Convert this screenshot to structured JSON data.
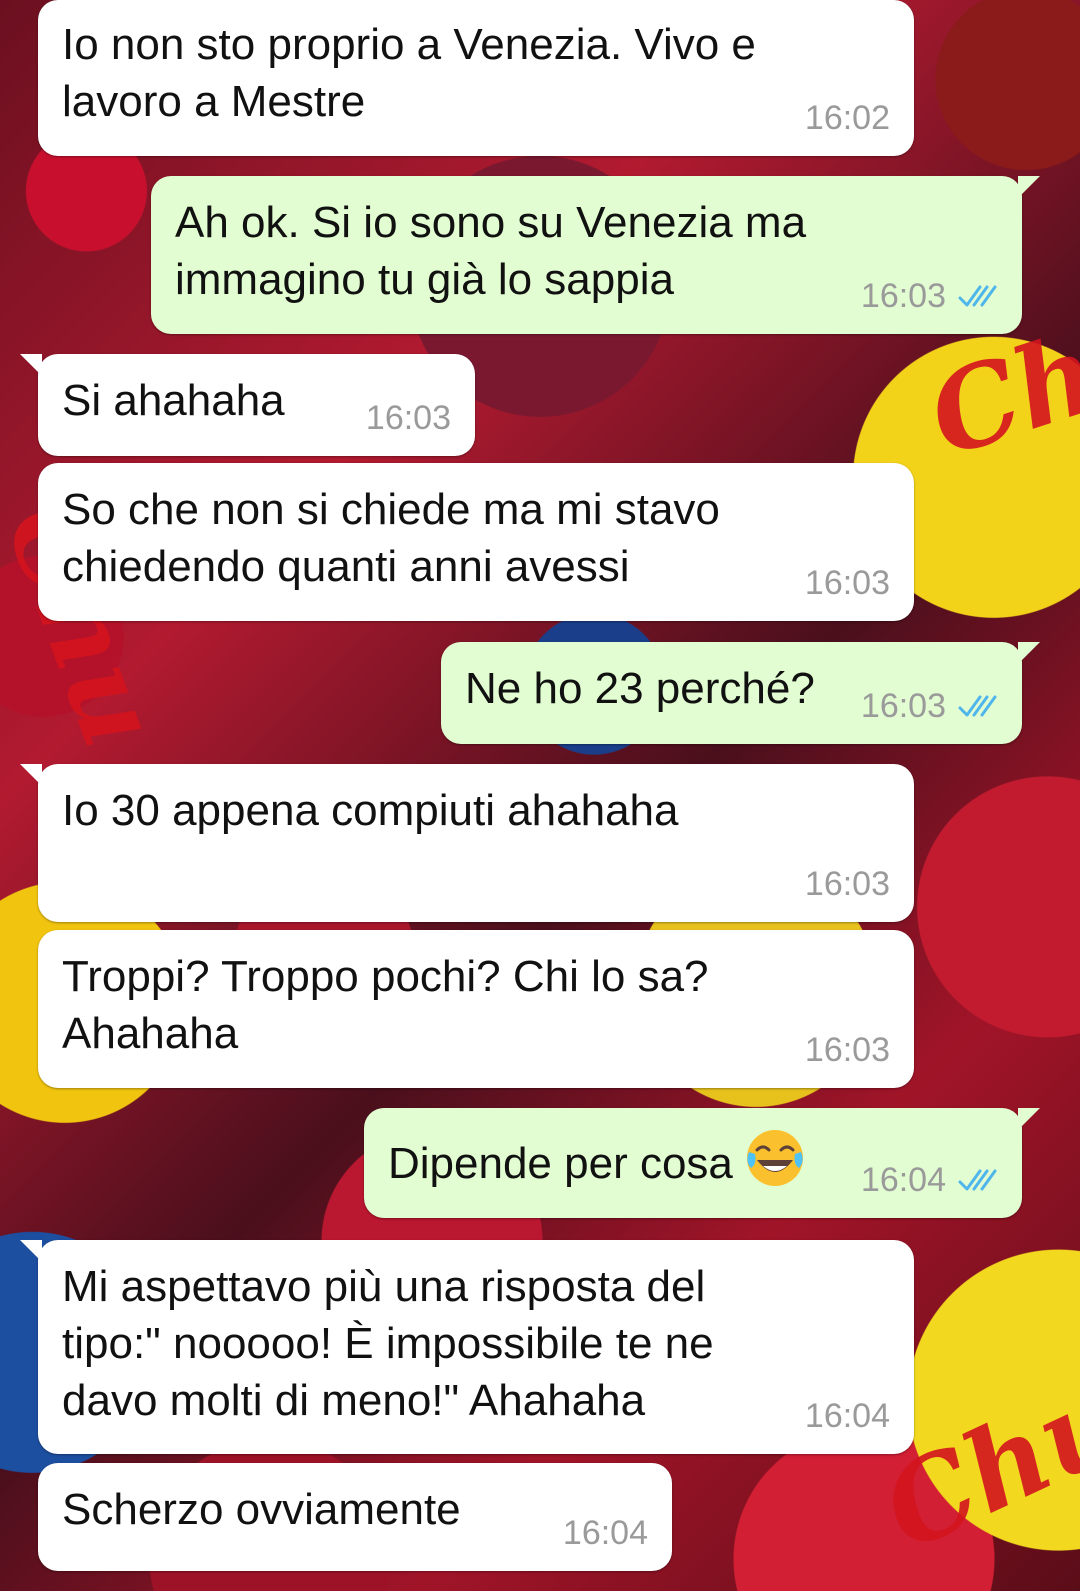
{
  "messages": [
    {
      "side": "in",
      "text": "Io non sto proprio a Venezia. Vivo e\nlavoro a Mestre",
      "time": "16:02"
    },
    {
      "side": "out",
      "text": "Ah ok. Si io sono su Venezia ma\nimmagino tu già lo sappia",
      "time": "16:03",
      "status": "read"
    },
    {
      "side": "in",
      "text": "Si ahahaha",
      "time": "16:03"
    },
    {
      "side": "in",
      "text": "So che non si chiede ma mi stavo\nchiedendo quanti anni avessi",
      "time": "16:03"
    },
    {
      "side": "out",
      "text": "Ne ho 23 perché?",
      "time": "16:03",
      "status": "read"
    },
    {
      "side": "in",
      "text": "Io 30 appena compiuti ahahaha",
      "time": "16:03"
    },
    {
      "side": "in",
      "text": "Troppi? Troppo pochi? Chi lo sa?\nAhahaha",
      "time": "16:03"
    },
    {
      "side": "out",
      "text": "Dipende per cosa",
      "emoji": "face-with-tears-of-joy",
      "time": "16:04",
      "status": "read"
    },
    {
      "side": "in",
      "text": "Mi aspettavo più una risposta del\ntipo:\" nooooo! È impossibile te ne\ndavo molti di meno!\" Ahahaha",
      "time": "16:04"
    },
    {
      "side": "in",
      "text": "Scherzo ovviamente",
      "time": "16:04"
    }
  ],
  "colors": {
    "incoming_bubble": "#ffffff",
    "outgoing_bubble": "#e2fdd1",
    "read_ticks": "#4fb6ec",
    "timestamp": "#9a9a9a"
  }
}
